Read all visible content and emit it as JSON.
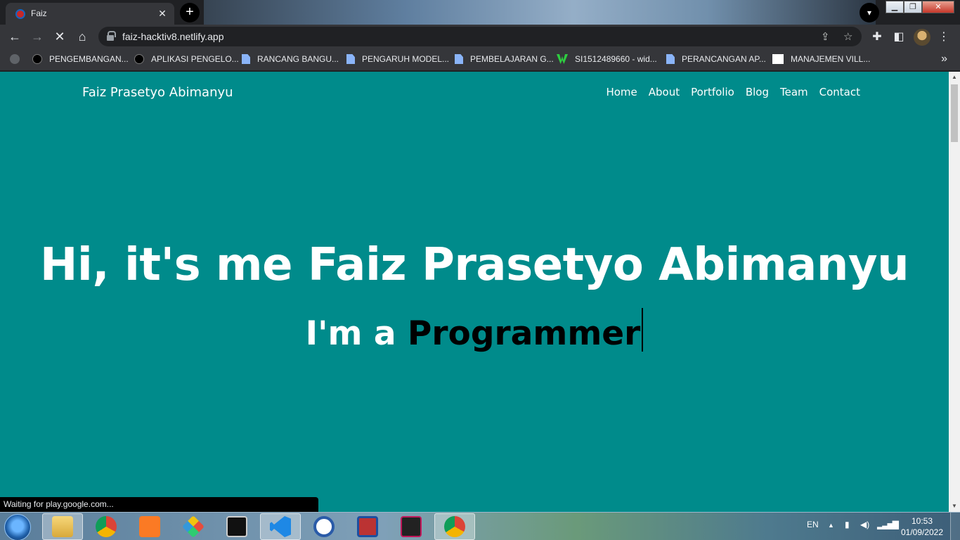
{
  "tab": {
    "title": "Faiz",
    "close": "✕"
  },
  "toolbar": {
    "url": "faiz-hacktiv8.netlify.app"
  },
  "bookmarks": [
    {
      "label": "PENGEMBANGAN...",
      "icon": "dark"
    },
    {
      "label": "APLIKASI PENGELO...",
      "icon": "dark-text"
    },
    {
      "label": "RANCANG BANGU...",
      "icon": "doc"
    },
    {
      "label": "PENGARUH MODEL...",
      "icon": "doc"
    },
    {
      "label": "PEMBELAJARAN G...",
      "icon": "doc"
    },
    {
      "label": "SI1512489660 - wid...",
      "icon": "green"
    },
    {
      "label": "PERANCANGAN AP...",
      "icon": "doc"
    },
    {
      "label": "MANAJEMEN VILL...",
      "icon": "white"
    }
  ],
  "site": {
    "brand": "Faiz Prasetyo Abimanyu",
    "menu": [
      "Home",
      "About",
      "Portfolio",
      "Blog",
      "Team",
      "Contact"
    ],
    "hero_title": "Hi, it's me Faiz Prasetyo Abimanyu",
    "hero_prefix": "I'm a ",
    "hero_role": "Programmer"
  },
  "status_bar": "Waiting for play.google.com...",
  "taskbar": {
    "lang": "EN",
    "time": "10:53",
    "date": "01/09/2022"
  },
  "colors": {
    "page_bg": "#008b8b",
    "chrome_dark": "#202124",
    "chrome_toolbar": "#35363a"
  }
}
